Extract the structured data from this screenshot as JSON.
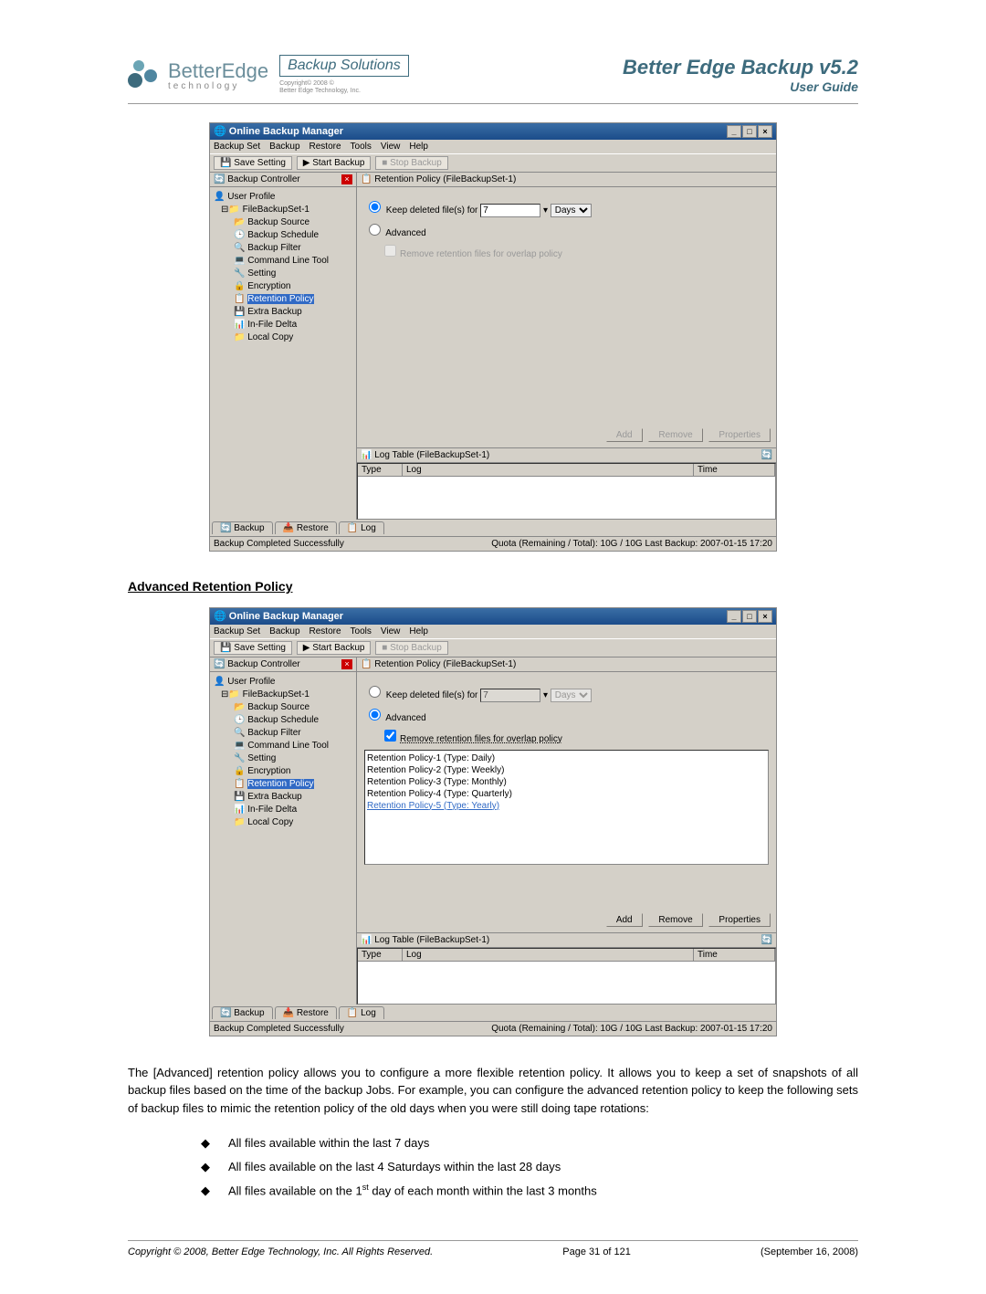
{
  "header": {
    "logo_name": "BetterEdge",
    "logo_sub": "technology",
    "box_label": "Backup Solutions",
    "box_caption1": "Copyright© 2008 ©",
    "box_caption2": "Better Edge Technology, Inc.",
    "title": "Better Edge Backup v5.2",
    "subtitle": "User Guide"
  },
  "win": {
    "title": "Online Backup Manager",
    "menus": [
      "Backup Set",
      "Backup",
      "Restore",
      "Tools",
      "View",
      "Help"
    ],
    "toolbar": {
      "save": "Save Setting",
      "start": "Start Backup",
      "stop": "Stop Backup"
    },
    "left_hdr": "Backup Controller",
    "tree": {
      "root": "User Profile",
      "set": "FileBackupSet-1",
      "items": [
        "Backup Source",
        "Backup Schedule",
        "Backup Filter",
        "Command Line Tool",
        "Setting",
        "Encryption",
        "Retention Policy",
        "Extra Backup",
        "In-File Delta",
        "Local Copy"
      ]
    },
    "panel_title": "Retention Policy (FileBackupSet-1)",
    "radio_keep": "Keep deleted file(s) for",
    "keep_value": "7",
    "keep_unit": "Days",
    "radio_adv": "Advanced",
    "chk_overlap": "Remove retention files for overlap policy",
    "policies": [
      "Retention Policy-1 (Type: Daily)",
      "Retention Policy-2 (Type: Weekly)",
      "Retention Policy-3 (Type: Monthly)",
      "Retention Policy-4 (Type: Quarterly)",
      "Retention Policy-5 (Type: Yearly)"
    ],
    "btns": {
      "add": "Add",
      "remove": "Remove",
      "props": "Properties"
    },
    "log_title": "Log Table (FileBackupSet-1)",
    "log_cols": {
      "type": "Type",
      "log": "Log",
      "time": "Time"
    },
    "tabs": {
      "backup": "Backup",
      "restore": "Restore",
      "log": "Log"
    },
    "status_left": "Backup Completed Successfully",
    "status_right": "Quota (Remaining / Total): 10G / 10G  Last Backup: 2007-01-15 17:20"
  },
  "section_title": "Advanced Retention Policy",
  "body_text": "The [Advanced] retention policy allows you to configure a more flexible retention policy. It allows you to keep a set of snapshots of all backup files based on the time of the backup Jobs. For example, you can configure the advanced retention policy to keep the following sets of backup files to mimic the retention policy of the old days when you were still doing tape rotations:",
  "bullets": [
    "All files available within the last 7 days",
    "All files available on the last 4 Saturdays within the last 28 days",
    "All files available on the 1st day of each month within the last 3 months"
  ],
  "footer": {
    "copyright": "Copyright © 2008, Better Edge Technology, Inc.   All Rights Reserved.",
    "page": "Page 31 of 121",
    "date": "(September 16, 2008)"
  }
}
